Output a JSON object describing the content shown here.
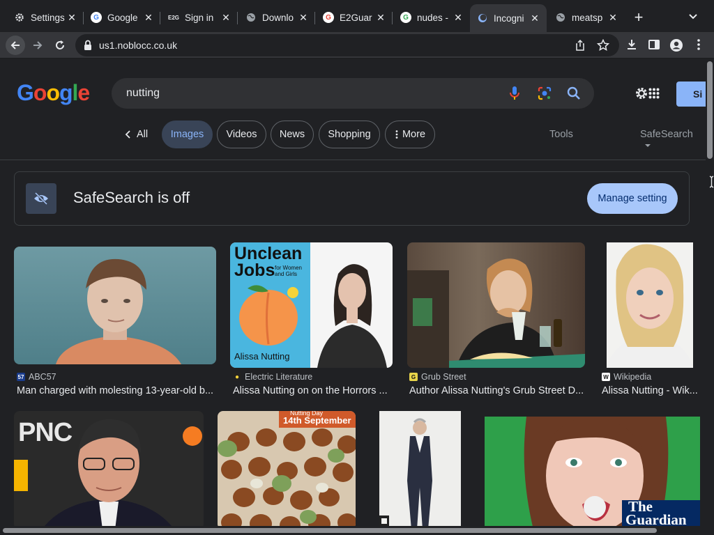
{
  "tabs": [
    {
      "title": "Settings",
      "icon": "gear-icon"
    },
    {
      "title": "Google",
      "icon": "google-icon"
    },
    {
      "title": "Sign in",
      "icon": "e2g-icon"
    },
    {
      "title": "Downlo",
      "icon": "globe-icon"
    },
    {
      "title": "E2Guar",
      "icon": "google-icon"
    },
    {
      "title": "nudes -",
      "icon": "google-icon"
    },
    {
      "title": "Incogni",
      "icon": "incognito-icon"
    },
    {
      "title": "meatsp",
      "icon": "globe-icon"
    }
  ],
  "new_tab_label": "+",
  "address_bar": {
    "url": "us1.noblocc.co.uk"
  },
  "google": {
    "logo_letters": [
      "G",
      "o",
      "o",
      "g",
      "l",
      "e"
    ],
    "query": "nutting",
    "signin_label": "Si"
  },
  "chips": {
    "all": "All",
    "images": "Images",
    "videos": "Videos",
    "news": "News",
    "shopping": "Shopping",
    "more": "More",
    "tools": "Tools",
    "safesearch": "SafeSearch"
  },
  "safesearch_banner": {
    "text": "SafeSearch is off",
    "button": "Manage setting"
  },
  "results": [
    {
      "source": "ABC57",
      "title": "Man charged with molesting 13-year-old b..."
    },
    {
      "source": "Electric Literature",
      "title": "Alissa Nutting on on the Horrors ..."
    },
    {
      "source": "Grub Street",
      "title": "Author Alissa Nutting's Grub Street D..."
    },
    {
      "source": "Wikipedia",
      "title": "Alissa Nutting - Wik..."
    }
  ],
  "thumb_text": {
    "book_title_1": "Unclean",
    "book_title_2": "Jobs",
    "book_sub": "for Women and Girls",
    "book_author": "Alissa Nutting",
    "pnc": "PNC",
    "nutting_day_1": "Nutting Day",
    "nutting_day_2": "14th September",
    "guardian_1": "The",
    "guardian_2": "Guardian"
  },
  "colors": {
    "accent": "#8ab4f8",
    "background": "#202124",
    "chip_active_bg": "#394457"
  }
}
